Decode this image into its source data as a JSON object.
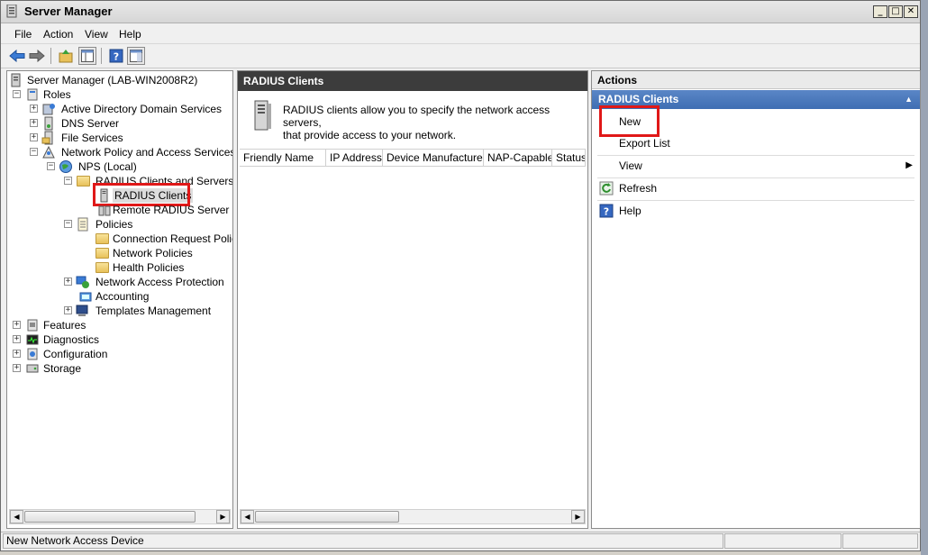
{
  "window": {
    "title": "Server Manager",
    "controls": [
      "_",
      "□",
      "✕"
    ]
  },
  "menu": [
    "File",
    "Action",
    "View",
    "Help"
  ],
  "toolbar": {
    "icons": [
      "back-arrow-icon",
      "forward-arrow-icon",
      "up-folder-icon",
      "show-hide-console-tree-icon",
      "help-icon",
      "properties-icon"
    ]
  },
  "tree": {
    "root": "Server Manager (LAB-WIN2008R2)",
    "roles": "Roles",
    "ad_ds": "Active Directory Domain Services",
    "dns": "DNS Server",
    "file": "File Services",
    "npas": "Network Policy and Access Services",
    "nps": "NPS (Local)",
    "radius_cs": "RADIUS Clients and Servers",
    "radius_clients": "RADIUS Clients",
    "remote_radius": "Remote RADIUS Server Gro",
    "policies": "Policies",
    "conn_req": "Connection Request Policies",
    "net_pol": "Network Policies",
    "health": "Health Policies",
    "nap": "Network Access Protection",
    "accounting": "Accounting",
    "templates": "Templates Management",
    "features": "Features",
    "diagnostics": "Diagnostics",
    "configuration": "Configuration",
    "storage": "Storage"
  },
  "middle": {
    "header": "RADIUS Clients",
    "description_line1": "RADIUS clients allow you to specify the network access servers,",
    "description_line2": "that provide access to your network.",
    "columns": [
      "Friendly Name",
      "IP Address",
      "Device Manufacturer",
      "NAP-Capable",
      "Status"
    ]
  },
  "actions": {
    "header": "Actions",
    "section": "RADIUS Clients",
    "items": {
      "new": "New",
      "export": "Export List",
      "view": "View",
      "refresh": "Refresh",
      "help": "Help"
    }
  },
  "status": {
    "text": "New Network Access Device"
  },
  "colors": {
    "highlight_box": "#e01818",
    "actions_section": "#4a78bb",
    "mid_header": "#3c3c3c"
  }
}
